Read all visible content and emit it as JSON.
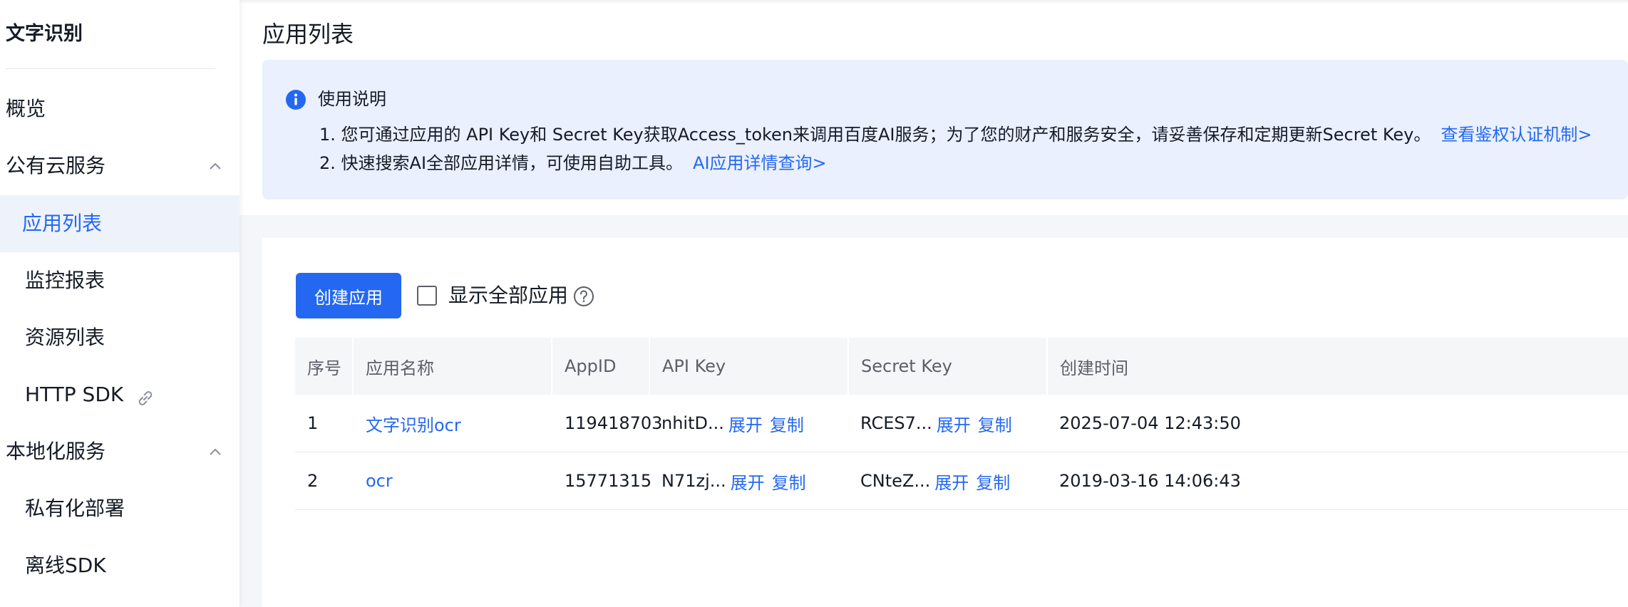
{
  "sidebar": {
    "title": "文字识别",
    "items": [
      {
        "label": "概览"
      },
      {
        "label": "公有云服务"
      },
      {
        "label": "应用列表"
      },
      {
        "label": "监控报表"
      },
      {
        "label": "资源列表"
      },
      {
        "label": "HTTP SDK"
      },
      {
        "label": "本地化服务"
      },
      {
        "label": "私有化部署"
      },
      {
        "label": "离线SDK"
      }
    ]
  },
  "page": {
    "title": "应用列表"
  },
  "notice": {
    "title": "使用说明",
    "line1_text": "1. 您可通过应用的 API Key和 Secret Key获取Access_token来调用百度AI服务；为了您的财产和服务安全，请妥善保存和定期更新Secret Key。",
    "line1_link": "查看鉴权认证机制>",
    "line2_text": "2. 快速搜索AI全部应用详情，可使用自助工具。",
    "line2_link": "AI应用详情查询>"
  },
  "toolbar": {
    "create_label": "创建应用",
    "show_all_label": "显示全部应用"
  },
  "table": {
    "headers": [
      "序号",
      "应用名称",
      "AppID",
      "API Key",
      "Secret Key",
      "创建时间"
    ],
    "rows": [
      {
        "index": "1",
        "name": "文字识别ocr",
        "app_id": "119418703",
        "api_key": "nhitD...",
        "secret_key": "RCES7...",
        "created": "2025-07-04 12:43:50"
      },
      {
        "index": "2",
        "name": "ocr",
        "app_id": "15771315",
        "api_key": "N71zj...",
        "secret_key": "CNteZ...",
        "created": "2019-03-16 14:06:43"
      }
    ],
    "expand_label": "展开",
    "copy_label": "复制"
  },
  "colors": {
    "accent": "#2468f2",
    "notice_bg": "#eaf0fd",
    "active_item_bg": "#eef2fb"
  },
  "icons": {
    "info": "info-icon",
    "help": "question-circle-icon",
    "collapse": "chevron-up-icon",
    "external": "link-icon"
  }
}
